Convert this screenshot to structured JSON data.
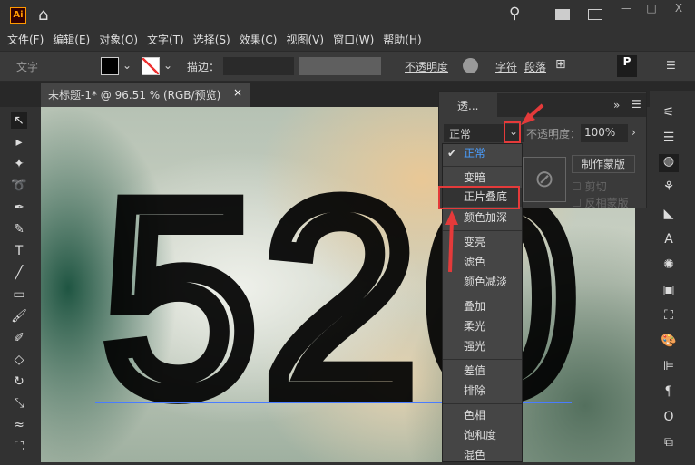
{
  "app": {
    "logo": "Ai",
    "window_controls": [
      "minimize",
      "maximize",
      "close"
    ]
  },
  "menu": [
    "文件(F)",
    "编辑(E)",
    "对象(O)",
    "文字(T)",
    "选择(S)",
    "效果(C)",
    "视图(V)",
    "窗口(W)",
    "帮助(H)"
  ],
  "control_bar": {
    "label": "文字",
    "stroke_label": "描边：",
    "opacity_link": "不透明度",
    "char_link": "字符",
    "para_link": "段落"
  },
  "document_tab": {
    "title": "未标题-1* @ 96.51 % (RGB/预览)",
    "close": "×"
  },
  "canvas": {
    "art_text": "520"
  },
  "transparency_panel": {
    "tab": "透...",
    "blend_mode": "正常",
    "opacity_label": "不透明度：",
    "opacity_value": "100%",
    "make_mask": "制作蒙版",
    "clip": "剪切",
    "invert_mask": "反相蒙版"
  },
  "blend_menu": {
    "selected": "正常",
    "groups": [
      [
        "正常"
      ],
      [
        "变暗",
        "正片叠底",
        "颜色加深"
      ],
      [
        "变亮",
        "滤色",
        "颜色减淡"
      ],
      [
        "叠加",
        "柔光",
        "强光"
      ],
      [
        "差值",
        "排除"
      ],
      [
        "色相",
        "饱和度",
        "混色"
      ]
    ]
  },
  "colors": {
    "accent": "#4a9eff",
    "highlight": "#e43a3a"
  }
}
